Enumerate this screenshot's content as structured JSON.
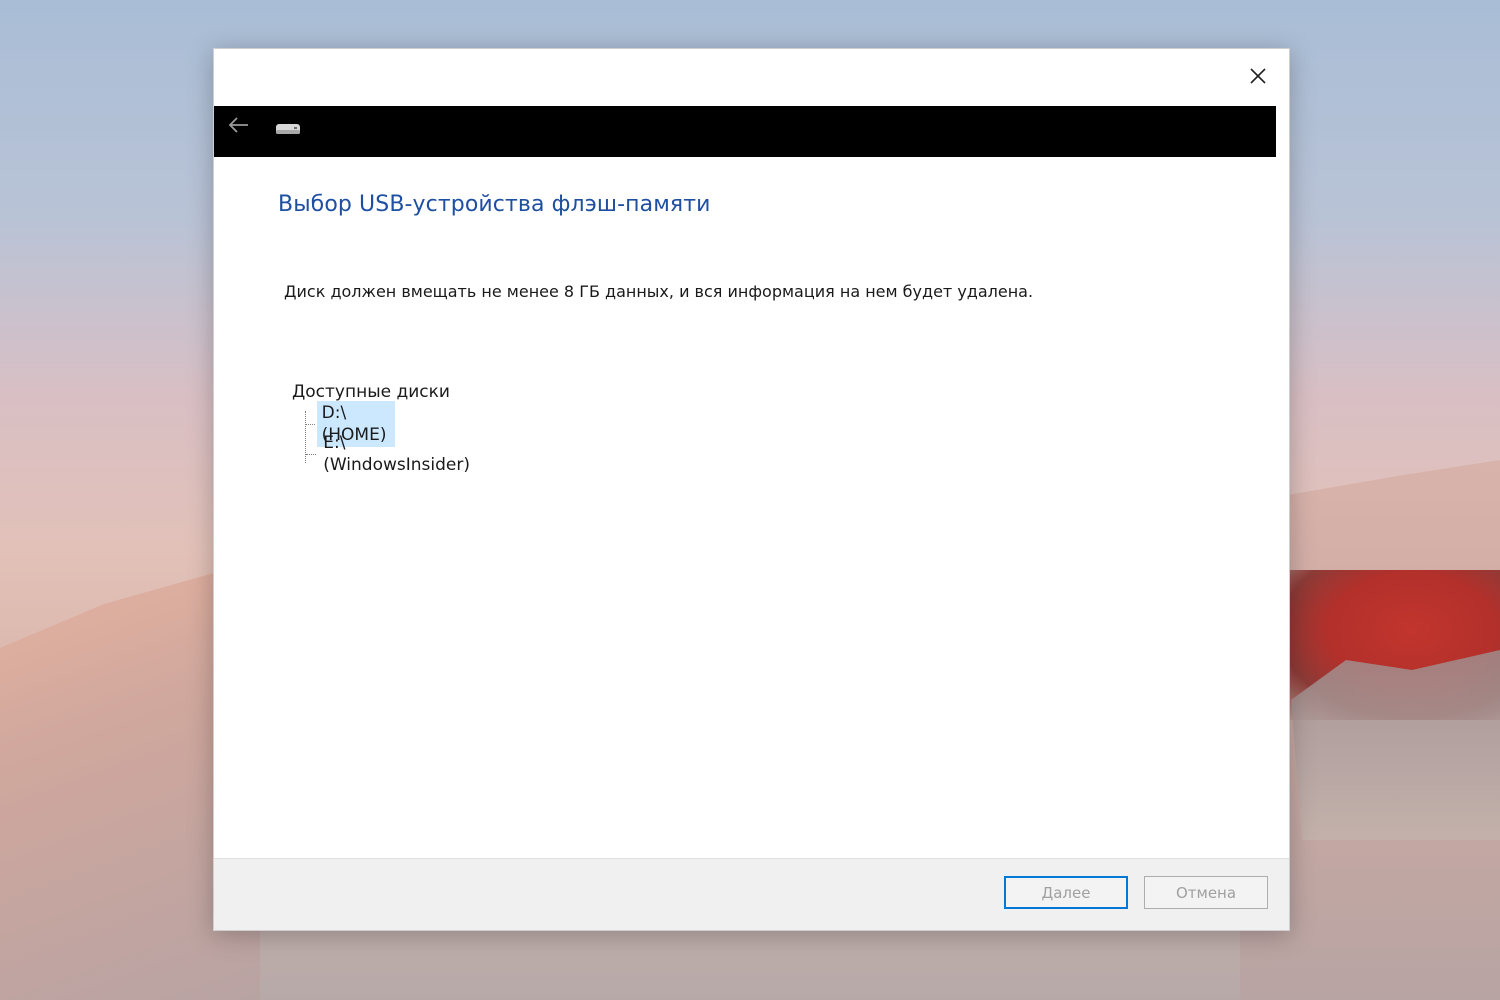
{
  "window": {
    "close_label": "Close"
  },
  "header": {
    "back_icon": "back-arrow-icon",
    "device_icon": "usb-drive-icon"
  },
  "main": {
    "title": "Выбор USB-устройства флэш-памяти",
    "description": "Диск должен вмещать не менее 8 ГБ данных, и вся информация на нем будет удалена.",
    "drives_label": "Доступные диски",
    "drives": [
      {
        "label": "D:\\ (HOME)",
        "selected": true
      },
      {
        "label": "E:\\ (WindowsInsider)",
        "selected": false
      }
    ]
  },
  "footer": {
    "next_label": "Далее",
    "cancel_label": "Отмена"
  },
  "colors": {
    "title": "#1f4fa0",
    "selection": "#cce8ff",
    "focus_border": "#0078d7"
  }
}
